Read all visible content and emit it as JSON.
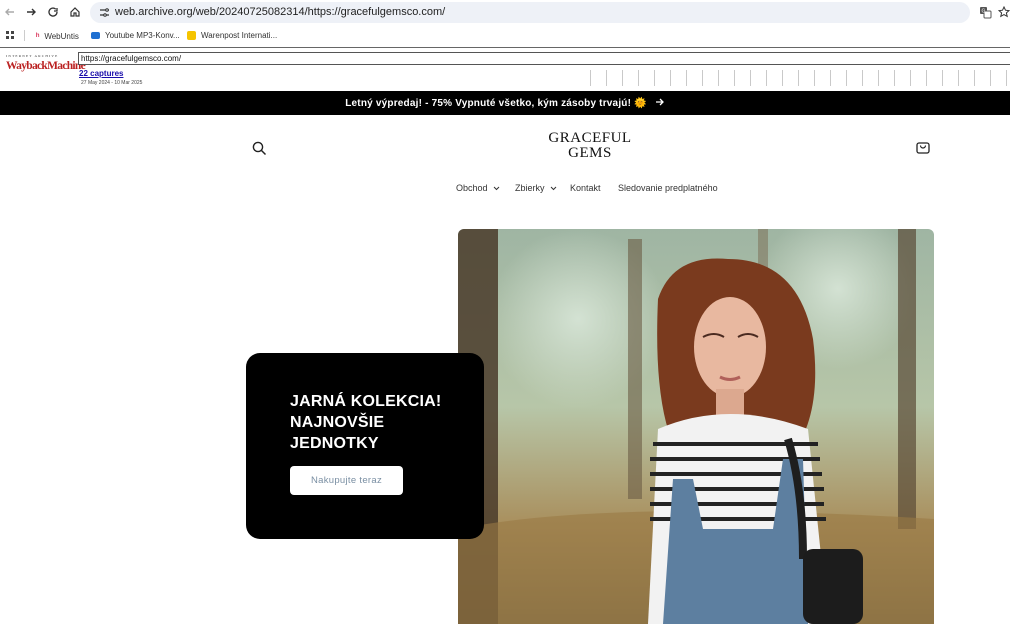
{
  "browser": {
    "url": "web.archive.org/web/20240725082314/https://gracefulgemsco.com/",
    "bookmarks": [
      "WebUntis",
      "Youtube MP3-Konv...",
      "Warenpost Internati..."
    ]
  },
  "wayback": {
    "logo_top": "INTERNET ARCHIVE",
    "logo_main": "WaybackMachine",
    "url": "https://gracefulgemsco.com/",
    "captures": "22 captures",
    "range": "27 May 2024 - 10 Mar 2025"
  },
  "announcement": "Letný výpredaj! - 75% Vypnuté všetko, kým zásoby trvajú! 🌞",
  "header": {
    "logo_line1": "GRACEFUL",
    "logo_line2": "GEMS"
  },
  "nav": {
    "shop": "Obchod",
    "collections": "Zbierky",
    "contact": "Kontakt",
    "tracking": "Sledovanie predplatného"
  },
  "hero": {
    "title": "JARNÁ KOLEKCIA! NAJNOVŠIE JEDNOTKY",
    "button": "Nakupujte teraz"
  },
  "colors": {
    "announce_bg": "#000000",
    "promo_bg": "#000000",
    "button_text": "#7a8fa3"
  }
}
